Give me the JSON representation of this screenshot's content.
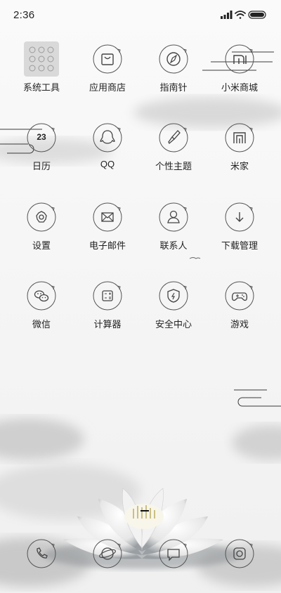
{
  "status_bar": {
    "time": "2:36"
  },
  "apps": [
    {
      "name": "system-tools",
      "label": "系统工具",
      "icon": "folder-grid-icon"
    },
    {
      "name": "app-store",
      "label": "应用商店",
      "icon": "shopping-bag-icon"
    },
    {
      "name": "compass",
      "label": "指南针",
      "icon": "compass-icon"
    },
    {
      "name": "mi-store",
      "label": "小米商城",
      "icon": "mi-logo-icon"
    },
    {
      "name": "calendar",
      "label": "日历",
      "icon": "calendar-icon",
      "badge": "23"
    },
    {
      "name": "qq",
      "label": "QQ",
      "icon": "qq-penguin-icon"
    },
    {
      "name": "themes",
      "label": "个性主题",
      "icon": "paintbrush-icon"
    },
    {
      "name": "mi-home",
      "label": "米家",
      "icon": "mi-home-icon"
    },
    {
      "name": "settings",
      "label": "设置",
      "icon": "gear-icon"
    },
    {
      "name": "email",
      "label": "电子邮件",
      "icon": "envelope-icon"
    },
    {
      "name": "contacts",
      "label": "联系人",
      "icon": "person-icon"
    },
    {
      "name": "downloads",
      "label": "下载管理",
      "icon": "download-arrow-icon"
    },
    {
      "name": "wechat",
      "label": "微信",
      "icon": "wechat-icon"
    },
    {
      "name": "calculator",
      "label": "计算器",
      "icon": "calculator-icon"
    },
    {
      "name": "security",
      "label": "安全中心",
      "icon": "shield-icon"
    },
    {
      "name": "games",
      "label": "游戏",
      "icon": "gamepad-icon"
    }
  ],
  "dock": [
    {
      "name": "phone",
      "icon": "phone-icon"
    },
    {
      "name": "browser",
      "icon": "globe-icon"
    },
    {
      "name": "messages",
      "icon": "message-icon"
    },
    {
      "name": "camera",
      "icon": "camera-icon"
    }
  ],
  "colors": {
    "icon_stroke": "#555555",
    "label_text": "#222222",
    "background": "#f6f6f6"
  }
}
